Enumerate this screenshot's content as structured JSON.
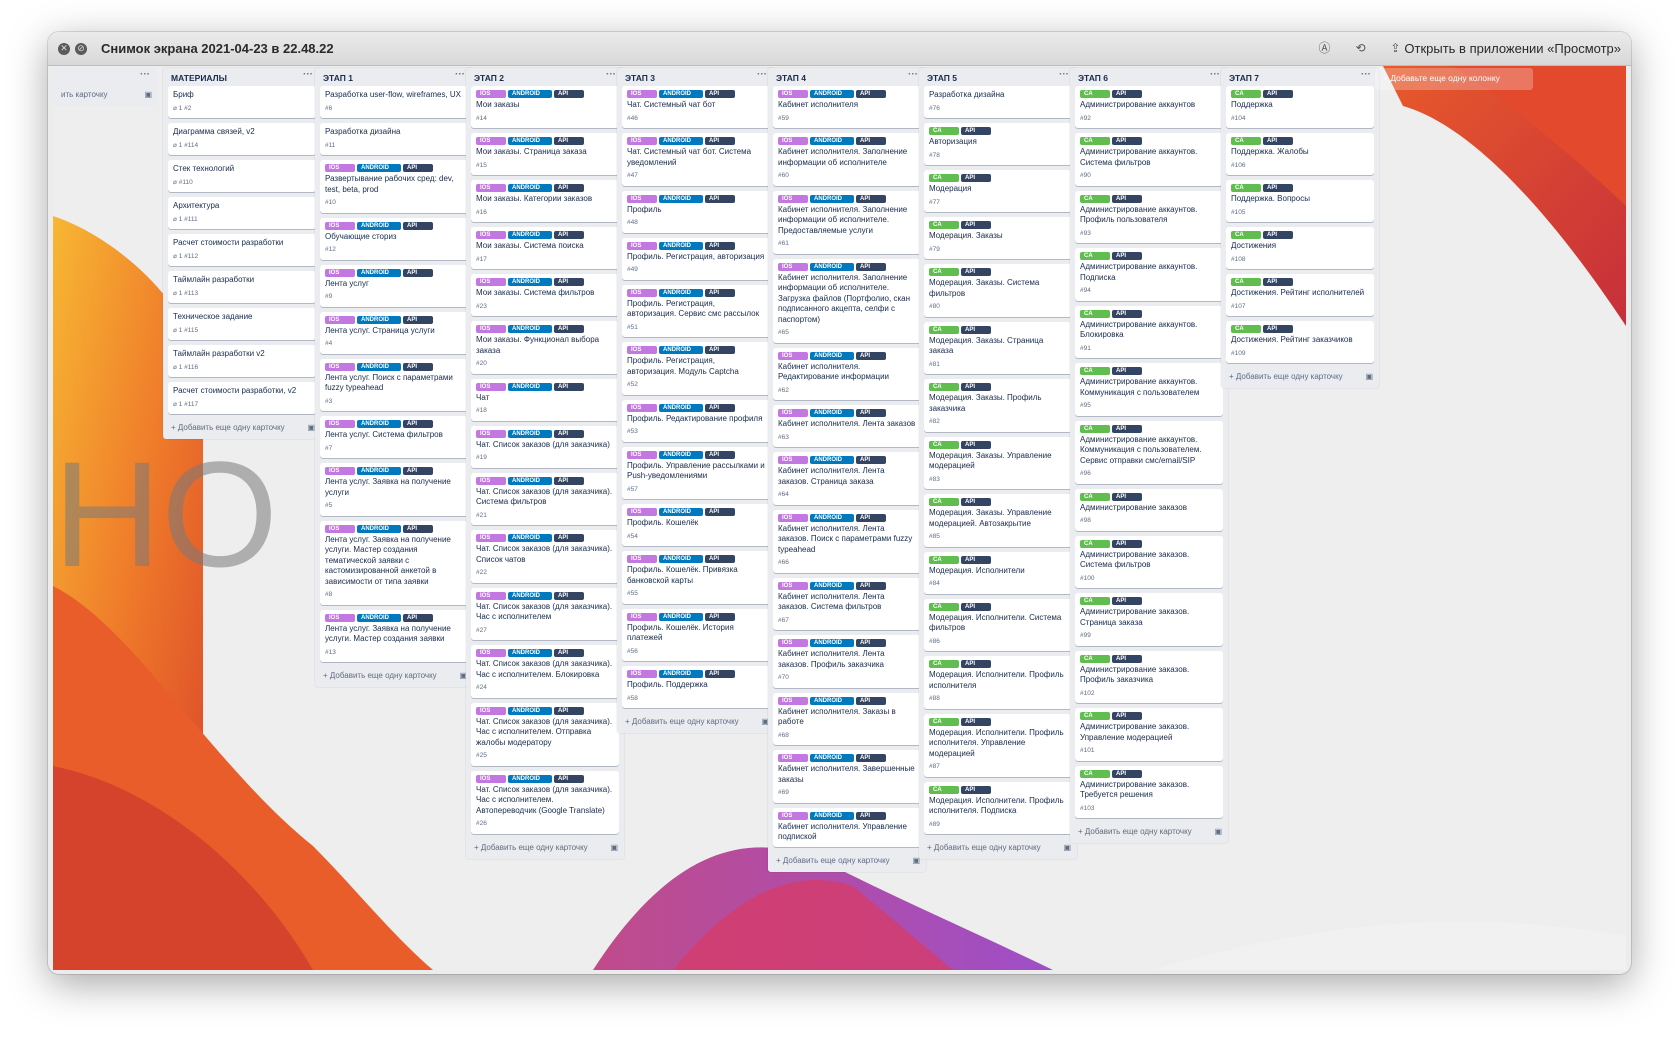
{
  "window": {
    "title": "Снимок экрана 2021-04-23 в 22.48.22",
    "open_in_app": "Открыть в приложении «Просмотр»",
    "toolbar_icons": [
      "markup-icon",
      "rotate-icon",
      "share-icon"
    ]
  },
  "board": {
    "watermark": "HO                    PPS",
    "add_card_label": "+ Добавить еще одну карточку",
    "add_column_label": "+ Добавьте еще одну колонку",
    "partial_column": {
      "add_card_label": "ить карточку"
    },
    "colors": {
      "ios": "#c377e0",
      "android": "#0079bf",
      "api": "#344563",
      "ca": "#61bd4f",
      "board_bg": "#e26a2c"
    },
    "columns": [
      {
        "title": "МАТЕРИАЛЫ",
        "cards": [
          {
            "title": "Бриф",
            "meta": "1   #2"
          },
          {
            "title": "Диаграмма связей, v2",
            "meta": "1   #114"
          },
          {
            "title": "Стек технологий",
            "meta": "#110"
          },
          {
            "title": "Архитектура",
            "meta": "1   #111"
          },
          {
            "title": "Расчет стоимости разработки",
            "meta": "1   #112"
          },
          {
            "title": "Таймлайн разработки",
            "meta": "1   #113"
          },
          {
            "title": "Техническое задание",
            "meta": "1   #115"
          },
          {
            "title": "Таймлайн разработки v2",
            "meta": "1   #116"
          },
          {
            "title": "Расчет стоимости разработки, v2",
            "meta": "1   #117"
          }
        ]
      },
      {
        "title": "ЭТАП 1",
        "cards": [
          {
            "title": "Разработка user-flow, wireframes, UX",
            "num": "#6"
          },
          {
            "title": "Разработка дизайна",
            "num": "#11"
          },
          {
            "labels": [
              "IOS",
              "ANDROID",
              "API"
            ],
            "title": "Развертывание рабочих сред: dev, test, beta, prod",
            "num": "#10"
          },
          {
            "labels": [
              "IOS",
              "ANDROID",
              "API"
            ],
            "title": "Обучающие сториз",
            "num": "#12"
          },
          {
            "labels": [
              "IOS",
              "ANDROID",
              "API"
            ],
            "title": "Лента услуг",
            "num": "#9"
          },
          {
            "labels": [
              "IOS",
              "ANDROID",
              "API"
            ],
            "title": "Лента услуг. Страница услуги",
            "num": "#4"
          },
          {
            "labels": [
              "IOS",
              "ANDROID",
              "API"
            ],
            "title": "Лента услуг. Поиск с параметрами fuzzy typeahead",
            "num": "#3"
          },
          {
            "labels": [
              "IOS",
              "ANDROID",
              "API"
            ],
            "title": "Лента услуг. Система фильтров",
            "num": "#7"
          },
          {
            "labels": [
              "IOS",
              "ANDROID",
              "API"
            ],
            "title": "Лента услуг. Заявка на получение услуги",
            "num": "#5"
          },
          {
            "labels": [
              "IOS",
              "ANDROID",
              "API"
            ],
            "title": "Лента услуг. Заявка на получение услуги. Мастер создания тематической заявки с кастомизированной анкетой в зависимости от типа заявки",
            "num": "#8"
          },
          {
            "labels": [
              "IOS",
              "ANDROID",
              "API"
            ],
            "title": "Лента услуг. Заявка на получение услуги. Мастер создания заявки",
            "num": "#13"
          }
        ]
      },
      {
        "title": "ЭТАП 2",
        "cards": [
          {
            "labels": [
              "IOS",
              "ANDROID",
              "API"
            ],
            "title": "Мои заказы",
            "num": "#14"
          },
          {
            "labels": [
              "IOS",
              "ANDROID",
              "API"
            ],
            "title": "Мои заказы. Страница заказа",
            "num": "#15"
          },
          {
            "labels": [
              "IOS",
              "ANDROID",
              "API"
            ],
            "title": "Мои заказы. Категории заказов",
            "num": "#16"
          },
          {
            "labels": [
              "IOS",
              "ANDROID",
              "API"
            ],
            "title": "Мои заказы. Система поиска",
            "num": "#17"
          },
          {
            "labels": [
              "IOS",
              "ANDROID",
              "API"
            ],
            "title": "Мои заказы. Система фильтров",
            "num": "#23"
          },
          {
            "labels": [
              "IOS",
              "ANDROID",
              "API"
            ],
            "title": "Мои заказы. Функционал выбора заказа",
            "num": "#20"
          },
          {
            "labels": [
              "IOS",
              "ANDROID",
              "API"
            ],
            "title": "Чат",
            "num": "#18"
          },
          {
            "labels": [
              "IOS",
              "ANDROID",
              "API"
            ],
            "title": "Чат. Список заказов (для заказчика)",
            "num": "#19"
          },
          {
            "labels": [
              "IOS",
              "ANDROID",
              "API"
            ],
            "title": "Чат. Список заказов (для заказчика). Система фильтров",
            "num": "#21"
          },
          {
            "labels": [
              "IOS",
              "ANDROID",
              "API"
            ],
            "title": "Чат. Список заказов (для заказчика). Список чатов",
            "num": "#22"
          },
          {
            "labels": [
              "IOS",
              "ANDROID",
              "API"
            ],
            "title": "Чат. Список заказов (для заказчика). Час с исполнителем",
            "num": "#27"
          },
          {
            "labels": [
              "IOS",
              "ANDROID",
              "API"
            ],
            "title": "Чат. Список заказов (для заказчика). Час с исполнителем. Блокировка",
            "num": "#24"
          },
          {
            "labels": [
              "IOS",
              "ANDROID",
              "API"
            ],
            "title": "Чат. Список заказов (для заказчика). Час с исполнителем. Отправка жалобы модератору",
            "num": "#25"
          },
          {
            "labels": [
              "IOS",
              "ANDROID",
              "API"
            ],
            "title": "Чат. Список заказов (для заказчика). Час с исполнителем. Автопереводчик (Google Translate)",
            "num": "#26"
          }
        ]
      },
      {
        "title": "ЭТАП 3",
        "cards": [
          {
            "labels": [
              "IOS",
              "ANDROID",
              "API"
            ],
            "title": "Чат. Системный чат бот",
            "num": "#46"
          },
          {
            "labels": [
              "IOS",
              "ANDROID",
              "API"
            ],
            "title": "Чат. Системный чат бот. Система уведомлений",
            "num": "#47"
          },
          {
            "labels": [
              "IOS",
              "ANDROID",
              "API"
            ],
            "title": "Профиль",
            "num": "#48"
          },
          {
            "labels": [
              "IOS",
              "ANDROID",
              "API"
            ],
            "title": "Профиль. Регистрация, авторизация",
            "num": "#49"
          },
          {
            "labels": [
              "IOS",
              "ANDROID",
              "API"
            ],
            "title": "Профиль. Регистрация, авторизация. Сервис смс рассылок",
            "num": "#51"
          },
          {
            "labels": [
              "IOS",
              "ANDROID",
              "API"
            ],
            "title": "Профиль. Регистрация, авторизация. Модуль Captcha",
            "num": "#52"
          },
          {
            "labels": [
              "IOS",
              "ANDROID",
              "API"
            ],
            "title": "Профиль. Редактирование профиля",
            "num": "#53"
          },
          {
            "labels": [
              "IOS",
              "ANDROID",
              "API"
            ],
            "title": "Профиль. Управление рассылками и Push-уведомлениями",
            "num": "#57"
          },
          {
            "labels": [
              "IOS",
              "ANDROID",
              "API"
            ],
            "title": "Профиль. Кошелёк",
            "num": "#54"
          },
          {
            "labels": [
              "IOS",
              "ANDROID",
              "API"
            ],
            "title": "Профиль. Кошелёк. Привязка банковской карты",
            "num": "#55"
          },
          {
            "labels": [
              "IOS",
              "ANDROID",
              "API"
            ],
            "title": "Профиль. Кошелёк. История платежей",
            "num": "#56"
          },
          {
            "labels": [
              "IOS",
              "ANDROID",
              "API"
            ],
            "title": "Профиль. Поддержка",
            "num": "#58"
          }
        ]
      },
      {
        "title": "ЭТАП 4",
        "cards": [
          {
            "labels": [
              "IOS",
              "ANDROID",
              "API"
            ],
            "title": "Кабинет исполнителя",
            "num": "#59"
          },
          {
            "labels": [
              "IOS",
              "ANDROID",
              "API"
            ],
            "title": "Кабинет исполнителя. Заполнение информации об исполнителе",
            "num": "#60"
          },
          {
            "labels": [
              "IOS",
              "ANDROID",
              "API"
            ],
            "title": "Кабинет исполнителя. Заполнение информации об исполнителе. Предоставляемые услуги",
            "num": "#61"
          },
          {
            "labels": [
              "IOS",
              "ANDROID",
              "API"
            ],
            "title": "Кабинет исполнителя. Заполнение информации об исполнителе. Загрузка файлов (Портфолио, скан подписанного акцепта, селфи с паспортом)",
            "num": "#65"
          },
          {
            "labels": [
              "IOS",
              "ANDROID",
              "API"
            ],
            "title": "Кабинет исполнителя. Редактирование информации",
            "num": "#62"
          },
          {
            "labels": [
              "IOS",
              "ANDROID",
              "API"
            ],
            "title": "Кабинет исполнителя. Лента заказов",
            "num": "#63"
          },
          {
            "labels": [
              "IOS",
              "ANDROID",
              "API"
            ],
            "title": "Кабинет исполнителя. Лента заказов. Страница заказа",
            "num": "#64"
          },
          {
            "labels": [
              "IOS",
              "ANDROID",
              "API"
            ],
            "title": "Кабинет исполнителя. Лента заказов. Поиск с параметрами fuzzy typeahead",
            "num": "#66"
          },
          {
            "labels": [
              "IOS",
              "ANDROID",
              "API"
            ],
            "title": "Кабинет исполнителя. Лента заказов. Система фильтров",
            "num": "#67"
          },
          {
            "labels": [
              "IOS",
              "ANDROID",
              "API"
            ],
            "title": "Кабинет исполнителя. Лента заказов. Профиль заказчика",
            "num": "#70"
          },
          {
            "labels": [
              "IOS",
              "ANDROID",
              "API"
            ],
            "title": "Кабинет исполнителя. Заказы в работе",
            "num": "#68"
          },
          {
            "labels": [
              "IOS",
              "ANDROID",
              "API"
            ],
            "title": "Кабинет исполнителя. Завершенные заказы",
            "num": "#69"
          },
          {
            "labels": [
              "IOS",
              "ANDROID",
              "API"
            ],
            "title": "Кабинет исполнителя. Управление подпиской",
            "num": ""
          }
        ]
      },
      {
        "title": "ЭТАП 5",
        "cards": [
          {
            "title": "Разработка дизайна",
            "num": "#76"
          },
          {
            "labels": [
              "CA",
              "API"
            ],
            "title": "Авторизация",
            "num": "#78"
          },
          {
            "labels": [
              "CA",
              "API"
            ],
            "title": "Модерация",
            "num": "#77"
          },
          {
            "labels": [
              "CA",
              "API"
            ],
            "title": "Модерация. Заказы",
            "num": "#79"
          },
          {
            "labels": [
              "CA",
              "API"
            ],
            "title": "Модерация. Заказы. Система фильтров",
            "num": "#80"
          },
          {
            "labels": [
              "CA",
              "API"
            ],
            "title": "Модерация. Заказы. Страница заказа",
            "num": "#81"
          },
          {
            "labels": [
              "CA",
              "API"
            ],
            "title": "Модерация. Заказы. Профиль заказчика",
            "num": "#82"
          },
          {
            "labels": [
              "CA",
              "API"
            ],
            "title": "Модерация. Заказы. Управление модерацией",
            "num": "#83"
          },
          {
            "labels": [
              "CA",
              "API"
            ],
            "title": "Модерация. Заказы. Управление модерацией. Автозакрытие",
            "num": "#85"
          },
          {
            "labels": [
              "CA",
              "API"
            ],
            "title": "Модерация. Исполнители",
            "num": "#84"
          },
          {
            "labels": [
              "CA",
              "API"
            ],
            "title": "Модерация. Исполнители. Система фильтров",
            "num": "#86"
          },
          {
            "labels": [
              "CA",
              "API"
            ],
            "title": "Модерация. Исполнители. Профиль исполнителя",
            "num": "#88"
          },
          {
            "labels": [
              "CA",
              "API"
            ],
            "title": "Модерация. Исполнители. Профиль исполнителя. Управление модерацией",
            "num": "#87"
          },
          {
            "labels": [
              "CA",
              "API"
            ],
            "title": "Модерация. Исполнители. Профиль исполнителя. Подписка",
            "num": "#89"
          }
        ]
      },
      {
        "title": "ЭТАП 6",
        "cards": [
          {
            "labels": [
              "CA",
              "API"
            ],
            "title": "Администрирование аккаунтов",
            "num": "#92"
          },
          {
            "labels": [
              "CA",
              "API"
            ],
            "title": "Администрирование аккаунтов. Система фильтров",
            "num": "#90"
          },
          {
            "labels": [
              "CA",
              "API"
            ],
            "title": "Администрирование аккаунтов. Профиль пользователя",
            "num": "#93"
          },
          {
            "labels": [
              "CA",
              "API"
            ],
            "title": "Администрирование аккаунтов. Подписка",
            "num": "#94"
          },
          {
            "labels": [
              "CA",
              "API"
            ],
            "title": "Администрирование аккаунтов. Блокировка",
            "num": "#91"
          },
          {
            "labels": [
              "CA",
              "API"
            ],
            "title": "Администрирование аккаунтов. Коммуникация с пользователем",
            "num": "#95"
          },
          {
            "labels": [
              "CA",
              "API"
            ],
            "title": "Администрирование аккаунтов. Коммуникация с пользователем. Сервис отправки смс/email/SIP",
            "num": "#96"
          },
          {
            "labels": [
              "CA",
              "API"
            ],
            "title": "Администрирование заказов",
            "num": "#98"
          },
          {
            "labels": [
              "CA",
              "API"
            ],
            "title": "Администрирование заказов. Система фильтров",
            "num": "#100"
          },
          {
            "labels": [
              "CA",
              "API"
            ],
            "title": "Администрирование заказов. Страница заказа",
            "num": "#99"
          },
          {
            "labels": [
              "CA",
              "API"
            ],
            "title": "Администрирование заказов. Профиль заказчика",
            "num": "#102"
          },
          {
            "labels": [
              "CA",
              "API"
            ],
            "title": "Администрирование заказов. Управление модерацией",
            "num": "#101"
          },
          {
            "labels": [
              "CA",
              "API"
            ],
            "title": "Администрирование заказов. Требуется решения",
            "num": "#103"
          }
        ]
      },
      {
        "title": "ЭТАП 7",
        "cards": [
          {
            "labels": [
              "CA",
              "API"
            ],
            "title": "Поддержка",
            "num": "#104"
          },
          {
            "labels": [
              "CA",
              "API"
            ],
            "title": "Поддержка. Жалобы",
            "num": "#106"
          },
          {
            "labels": [
              "CA",
              "API"
            ],
            "title": "Поддержка. Вопросы",
            "num": "#105"
          },
          {
            "labels": [
              "CA",
              "API"
            ],
            "title": "Достижения",
            "num": "#108"
          },
          {
            "labels": [
              "CA",
              "API"
            ],
            "title": "Достижения. Рейтинг исполнителей",
            "num": "#107"
          },
          {
            "labels": [
              "CA",
              "API"
            ],
            "title": "Достижения. Рейтинг заказчиков",
            "num": "#109"
          }
        ]
      }
    ]
  }
}
